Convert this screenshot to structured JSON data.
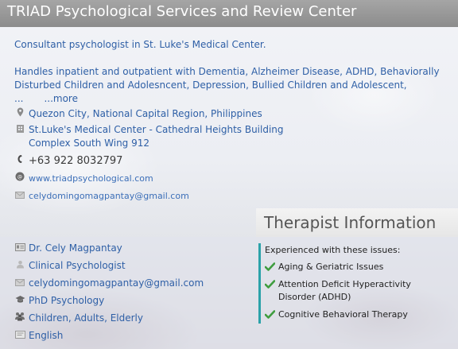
{
  "header": {
    "title": "TRIAD Psychological Services and Review Center"
  },
  "description": {
    "line1": "Consultant psychologist in St. Luke's Medical Center.",
    "line2": "Handles inpatient and outpatient with Dementia, Alzheimer Disease, ADHD, Behaviorally Disturbed Children and Adolesncent, Depression, Bullied Children and Adolescent, ...",
    "more": "...more"
  },
  "contact": {
    "location": "Quezon City, National Capital Region, Philippines",
    "address_line1": "St.Luke's Medical Center - Cathedral Heights Building",
    "address_line2": "Complex South Wing 912",
    "phone": "+63 922 8032797",
    "website": "www.triadpsychological.com",
    "email": "celydomingomagpantay@gmail.com"
  },
  "therapist_info": {
    "tab_title": "Therapist Information",
    "name": "Dr. Cely Magpantay",
    "title": "Clinical Psychologist",
    "email": "celydomingomagpantay@gmail.com",
    "degree": "PhD Psychology",
    "clients": "Children, Adults, Elderly",
    "language": "English"
  },
  "issues": {
    "heading": "Experienced with these issues:",
    "items": [
      "Aging & Geriatric Issues",
      "Attention Deficit Hyperactivity Disorder (ADHD)",
      "Cognitive Behavioral Therapy"
    ]
  },
  "colors": {
    "header": "#999999",
    "link": "#2e5fa6",
    "accent": "#2ba2a9",
    "check": "#3f9d3f"
  },
  "icons": [
    "map-pin-icon",
    "building-icon",
    "phone-icon",
    "globe-icon",
    "email-icon",
    "id-card-icon",
    "person-icon",
    "graduation-cap-icon",
    "group-icon",
    "language-icon",
    "checkmark-icon"
  ]
}
